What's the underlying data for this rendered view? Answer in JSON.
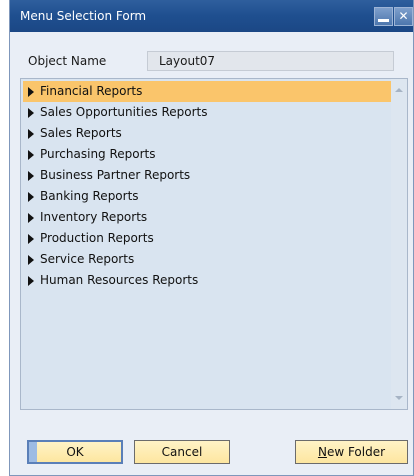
{
  "window": {
    "title": "Menu Selection Form"
  },
  "form": {
    "object_name_label": "Object Name",
    "object_name_value": "Layout07"
  },
  "tree": {
    "selected_index": 0,
    "items": [
      {
        "label": "Financial Reports"
      },
      {
        "label": "Sales Opportunities Reports"
      },
      {
        "label": "Sales Reports"
      },
      {
        "label": "Purchasing Reports"
      },
      {
        "label": "Business Partner Reports"
      },
      {
        "label": "Banking Reports"
      },
      {
        "label": "Inventory Reports"
      },
      {
        "label": "Production Reports"
      },
      {
        "label": "Service Reports"
      },
      {
        "label": "Human Resources Reports"
      }
    ]
  },
  "buttons": {
    "ok_label": "OK",
    "cancel_label": "Cancel",
    "new_folder_mnemonic": "N",
    "new_folder_rest": "ew Folder"
  },
  "colors": {
    "title_bar": "#1f4f8f",
    "selected_item": "#fac56b",
    "tree_background": "#d9e4f0",
    "button_face": "#fde6a0"
  }
}
